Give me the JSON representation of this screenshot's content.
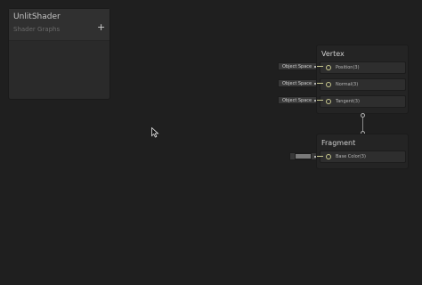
{
  "blackboard": {
    "title": "UnlitShader",
    "subtitle": "Shader Graphs",
    "add_label": "+"
  },
  "vertex": {
    "title": "Vertex",
    "slots": [
      {
        "label": "Position(3)",
        "drawer": "Object Space"
      },
      {
        "label": "Normal(3)",
        "drawer": "Object Space"
      },
      {
        "label": "Tangent(3)",
        "drawer": "Object Space"
      }
    ]
  },
  "fragment": {
    "title": "Fragment",
    "slots": [
      {
        "label": "Base Color(3)"
      }
    ],
    "base_color_value": "#7a7a7a"
  },
  "colors": {
    "background": "#1f1f1f",
    "port_accent": "#c9c98f"
  }
}
